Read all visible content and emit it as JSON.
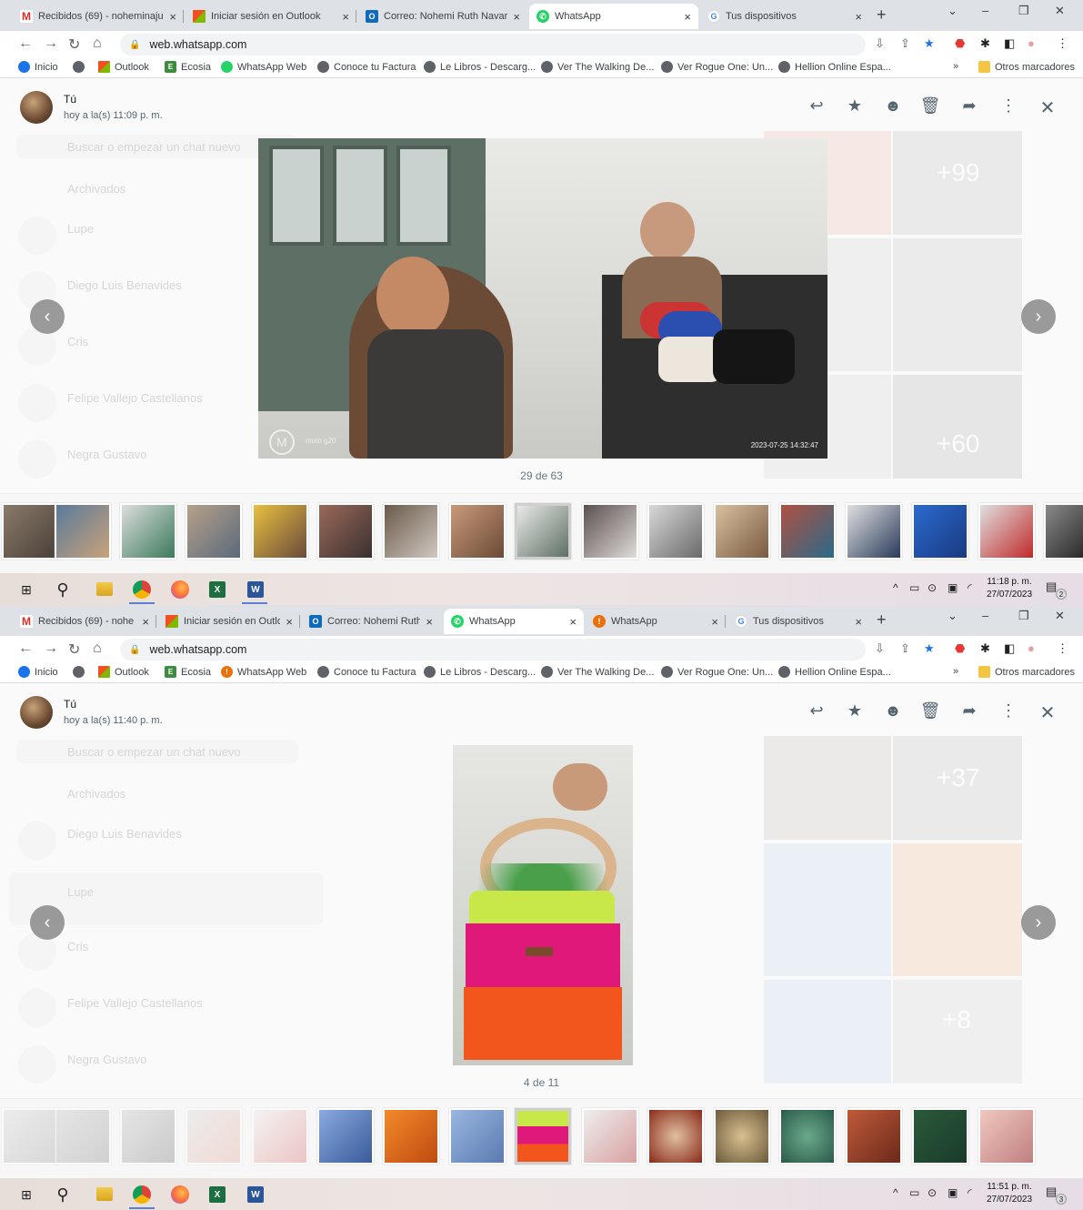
{
  "screens": [
    {
      "tabs": [
        {
          "label": "Recibidos (69) - noheminaju",
          "favicon": "gmail-icon"
        },
        {
          "label": "Iniciar sesión en Outlook",
          "favicon": "microsoft-icon"
        },
        {
          "label": "Correo: Nohemi Ruth Navarr",
          "favicon": "outlook-icon"
        },
        {
          "label": "WhatsApp",
          "favicon": "whatsapp-icon",
          "active": true
        },
        {
          "label": "Tus dispositivos",
          "favicon": "google-icon"
        }
      ],
      "url": "web.whatsapp.com",
      "bookmarks": [
        "Inicio",
        "",
        "Outlook",
        "Ecosia",
        "WhatsApp Web",
        "Conoce tu Factura",
        "Le Libros - Descarg...",
        "Ver The Walking De...",
        "Ver Rogue One: Un...",
        "Hellion Online Espa..."
      ],
      "bookmarks_overflow": "»",
      "other_bookmarks": "Otros marcadores",
      "sender": "Tú",
      "sent_time": "hoy a la(s) 11:09 p. m.",
      "counter": "29 de 63",
      "photo_watermark": "moto g20",
      "photo_timestamp": "2023-07-25 14:32:47",
      "ghost_chats": [
        "Buscar o empezar un chat nuevo",
        "Archivados",
        "Lupe",
        "Diego Luis Benavides",
        "Cris",
        "Felipe Vallejo Castellanos",
        "Negra Gustavo"
      ],
      "ghost_counts": [
        "+99",
        "+60"
      ],
      "clock_time": "11:18 p. m.",
      "clock_date": "27/07/2023",
      "notifications": "2"
    },
    {
      "tabs": [
        {
          "label": "Recibidos (69) - nohe",
          "favicon": "gmail-icon"
        },
        {
          "label": "Iniciar sesión en Outlo",
          "favicon": "microsoft-icon"
        },
        {
          "label": "Correo: Nohemi Ruth",
          "favicon": "outlook-icon"
        },
        {
          "label": "WhatsApp",
          "favicon": "whatsapp-icon",
          "active": true
        },
        {
          "label": "WhatsApp",
          "favicon": "error-icon"
        },
        {
          "label": "Tus dispositivos",
          "favicon": "google-icon"
        }
      ],
      "url": "web.whatsapp.com",
      "bookmarks": [
        "Inicio",
        "",
        "Outlook",
        "Ecosia",
        "WhatsApp Web",
        "Conoce tu Factura",
        "Le Libros - Descarg...",
        "Ver The Walking De...",
        "Ver Rogue One: Un...",
        "Hellion Online Espa..."
      ],
      "bookmarks_overflow": "»",
      "other_bookmarks": "Otros marcadores",
      "sender": "Tú",
      "sent_time": "hoy a la(s) 11:40 p. m.",
      "counter": "4 de 11",
      "ghost_chats": [
        "Buscar o empezar un chat nuevo",
        "Archivados",
        "Diego Luis Benavides",
        "Lupe",
        "Cris",
        "Felipe Vallejo Castellanos",
        "Negra Gustavo"
      ],
      "ghost_counts": [
        "+37",
        "+8"
      ],
      "clock_time": "11:51 p. m.",
      "clock_date": "27/07/2023",
      "notifications": "3"
    }
  ],
  "colors": {
    "chrome_tabstrip": "#dee1e6",
    "viewer_bg": "#fafafa",
    "icon_gray": "#54656f",
    "whatsapp_green": "#25d366"
  }
}
